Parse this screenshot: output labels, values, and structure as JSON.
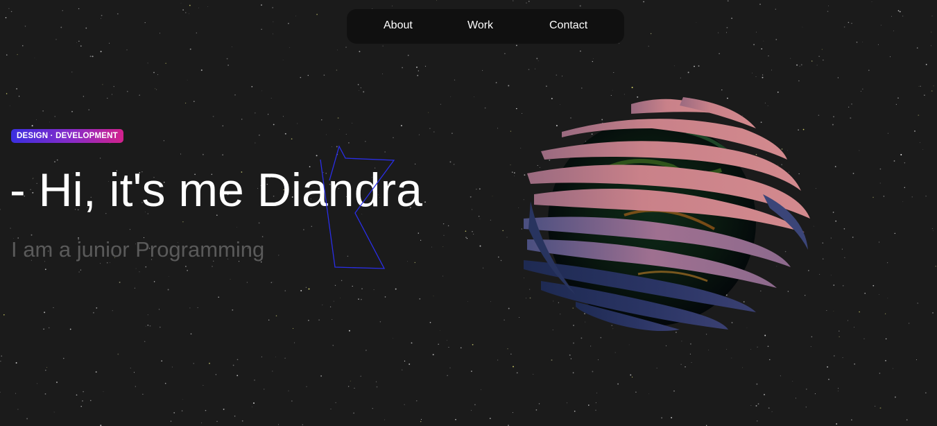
{
  "nav": {
    "items": [
      {
        "label": "About"
      },
      {
        "label": "Work"
      },
      {
        "label": "Contact"
      }
    ]
  },
  "hero": {
    "badge": "DESIGN · DEVELOPMENT",
    "headline": "- Hi, it's me Diandra",
    "subtitle": "I am a junior Programming"
  },
  "colors": {
    "background": "#1b1b1b",
    "nav_background": "#101010",
    "badge_gradient_start": "#3a2fe0",
    "badge_gradient_end": "#d2228c",
    "headline": "#ffffff",
    "subtitle": "#5a5a5a",
    "outline_shape": "#2a2ee8",
    "planet_rings_light": "#c97f86",
    "planet_rings_dark": "#25335e"
  },
  "visuals": {
    "starfield": "starfield-background",
    "outline_shape": "outline-polygon-graphic",
    "planet": "3d-planet-with-rings"
  }
}
